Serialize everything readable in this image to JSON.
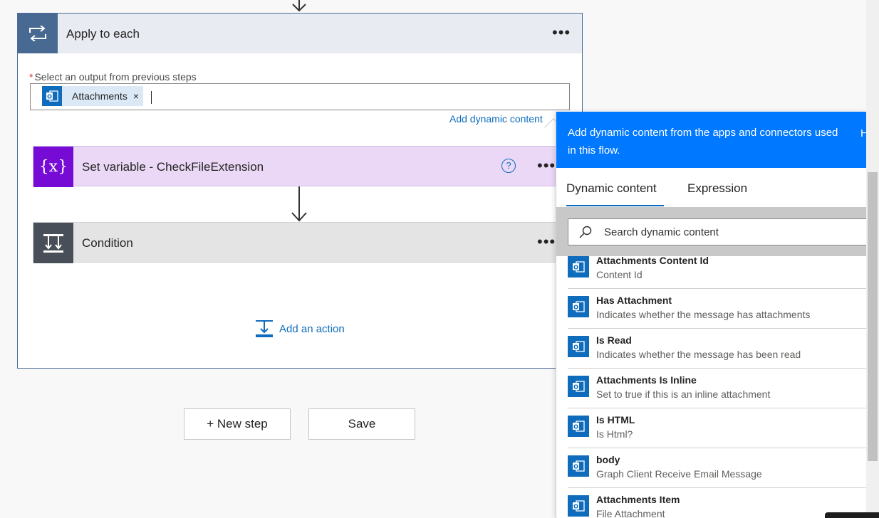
{
  "apply_each": {
    "title": "Apply to each",
    "field_label": "Select an output from previous steps",
    "token_label": "Attachments",
    "token_remove": "×",
    "add_dynamic_link": "Add dynamic content"
  },
  "steps": {
    "set_variable": {
      "title": "Set variable - CheckFileExtension",
      "icon_text": "{x}",
      "help": "?"
    },
    "condition": {
      "title": "Condition"
    }
  },
  "add_action": {
    "label": "Add an action"
  },
  "buttons": {
    "new_step": "+ New step",
    "save": "Save"
  },
  "panel": {
    "header_text": "Add dynamic content from the apps and connectors used in this flow.",
    "header_extra": "H",
    "tabs": [
      "Dynamic content",
      "Expression"
    ],
    "search_placeholder": "Search dynamic content",
    "items": [
      {
        "title": "Attachments Content Id",
        "desc": "Content Id"
      },
      {
        "title": "Has Attachment",
        "desc": "Indicates whether the message has attachments"
      },
      {
        "title": "Is Read",
        "desc": "Indicates whether the message has been read"
      },
      {
        "title": "Attachments Is Inline",
        "desc": "Set to true if this is an inline attachment"
      },
      {
        "title": "Is HTML",
        "desc": "Is Html?"
      },
      {
        "title": "body",
        "desc": "Graph Client Receive Email Message"
      },
      {
        "title": "Attachments Item",
        "desc": "File Attachment"
      }
    ]
  },
  "colors": {
    "accent": "#0f6cbd",
    "panel_header": "#0078ff",
    "variable": "#770bd6",
    "loop": "#486991"
  }
}
